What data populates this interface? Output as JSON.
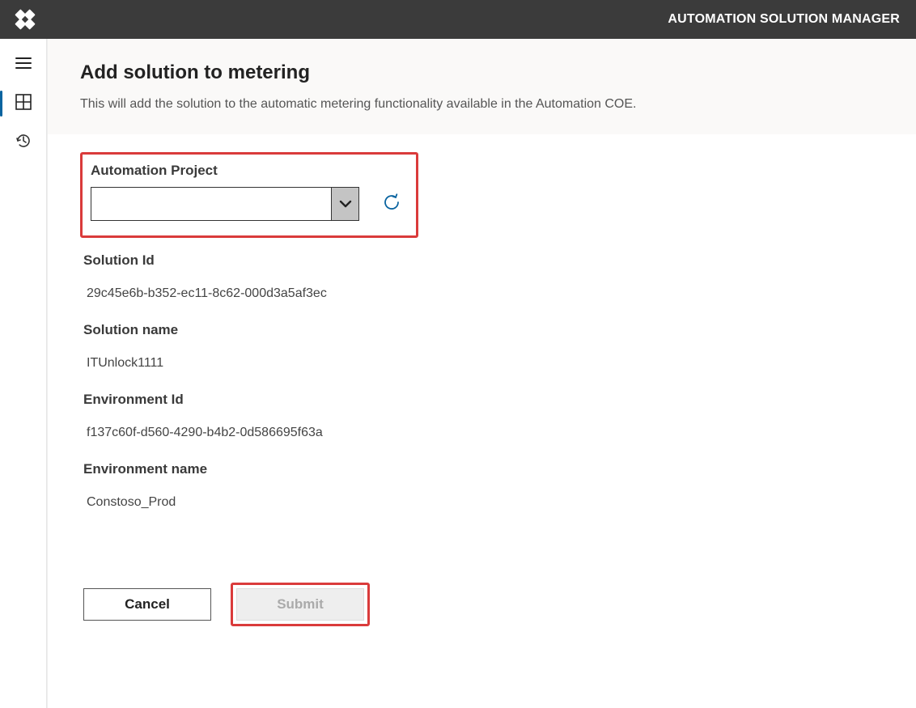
{
  "header": {
    "title": "AUTOMATION SOLUTION MANAGER"
  },
  "page": {
    "title": "Add solution to metering",
    "description": "This will add the solution to the automatic metering functionality available in the Automation COE."
  },
  "form": {
    "automation_project_label": "Automation Project",
    "automation_project_value": "",
    "solution_id_label": "Solution Id",
    "solution_id_value": "29c45e6b-b352-ec11-8c62-000d3a5af3ec",
    "solution_name_label": "Solution name",
    "solution_name_value": "ITUnlock1111",
    "environment_id_label": "Environment Id",
    "environment_id_value": "f137c60f-d560-4290-b4b2-0d586695f63a",
    "environment_name_label": "Environment name",
    "environment_name_value": "Constoso_Prod"
  },
  "buttons": {
    "cancel": "Cancel",
    "submit": "Submit"
  }
}
